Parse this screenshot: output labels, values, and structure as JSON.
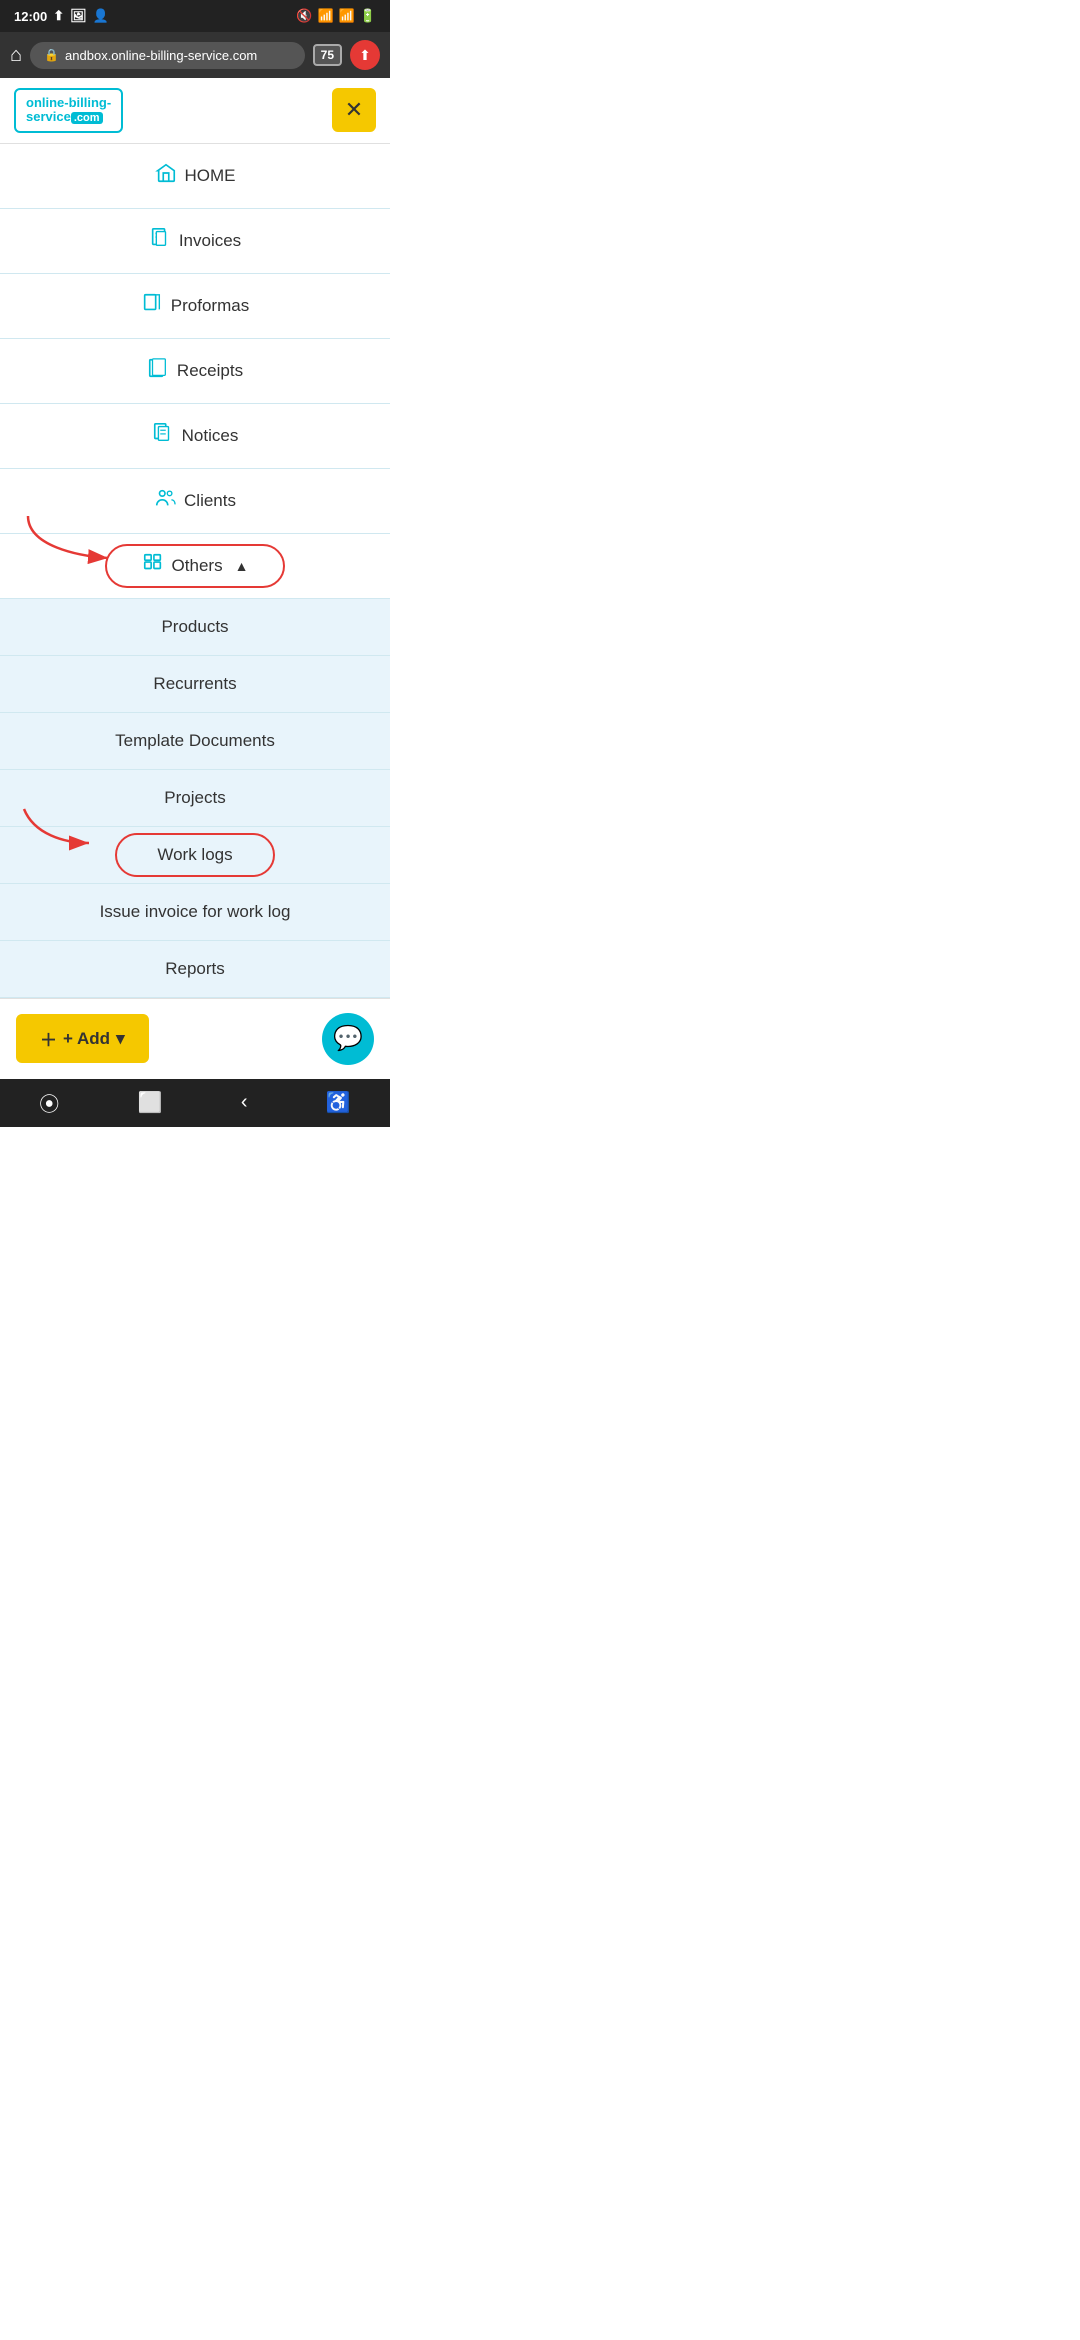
{
  "statusBar": {
    "time": "12:00",
    "tabCount": "75"
  },
  "browserBar": {
    "url": "andbox.online-billing-service.com"
  },
  "logo": {
    "line1": "online-billing-",
    "line2": "service",
    "com": ".com"
  },
  "nav": {
    "items": [
      {
        "id": "home",
        "label": "HOME",
        "icon": "home"
      },
      {
        "id": "invoices",
        "label": "Invoices",
        "icon": "invoices"
      },
      {
        "id": "proformas",
        "label": "Proformas",
        "icon": "proformas"
      },
      {
        "id": "receipts",
        "label": "Receipts",
        "icon": "receipts"
      },
      {
        "id": "notices",
        "label": "Notices",
        "icon": "notices"
      },
      {
        "id": "clients",
        "label": "Clients",
        "icon": "clients"
      },
      {
        "id": "others",
        "label": "Others",
        "icon": "others",
        "expanded": true,
        "chevron": "▲"
      }
    ],
    "submenu": [
      {
        "id": "products",
        "label": "Products"
      },
      {
        "id": "recurrents",
        "label": "Recurrents"
      },
      {
        "id": "template-documents",
        "label": "Template Documents"
      },
      {
        "id": "projects",
        "label": "Projects"
      },
      {
        "id": "work-logs",
        "label": "Work logs"
      },
      {
        "id": "issue-invoice",
        "label": "Issue invoice for work log"
      },
      {
        "id": "reports",
        "label": "Reports"
      }
    ]
  },
  "footer": {
    "addLabel": "+ Add",
    "addChevron": "▾"
  },
  "annotations": {
    "othersCircleLabel": "Others circled in red",
    "worklogsCircleLabel": "Work logs circled in red"
  }
}
